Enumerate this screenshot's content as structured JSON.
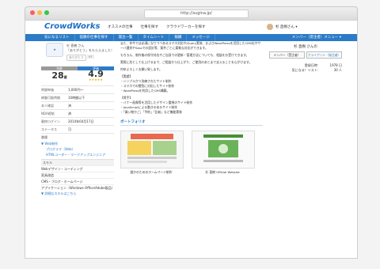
{
  "browser": {
    "url": "http://sugina.jp/"
  },
  "header": {
    "logo": "CrowdWorks",
    "links": [
      "オススメの仕事",
      "仕事を探す",
      "クラウドワーカーを探す"
    ],
    "user": "杉 直樹さん ▾"
  },
  "nav": {
    "items": [
      "気になるリスト",
      "宿題の仕事を探す",
      "発注一覧",
      "タイムシート",
      "報酬",
      "メッセージ"
    ],
    "right": "メンバー（受注者）メニュー ▾"
  },
  "profile": {
    "name": "杉 直樹 さん",
    "catch": "「ありがとう」をもらえました！",
    "thanks_label": "ありがとう",
    "thanks_count": "97",
    "stat_age_label": "年齢",
    "stat_age_value": "28",
    "stat_age_unit": "歳",
    "stat_rating_label": "評価",
    "stat_rating_value": "4.9",
    "stars": "★★★★★",
    "rows": [
      {
        "k": "時間単価",
        "v": "1,000円〜"
      },
      {
        "k": "稼働可能時間",
        "v": "10時間以下"
      },
      {
        "k": "本人確認",
        "v": "済"
      },
      {
        "k": "NDA締結",
        "v": "済"
      },
      {
        "k": "最終ログイン",
        "v": "2014年04月17日"
      },
      {
        "k": "ステータス",
        "v": "可"
      },
      {
        "k": "職種",
        "v": ""
      }
    ],
    "web_label": "▼ Web制作",
    "links": [
      "プログラマ（Web）",
      "HTMLコーダー・マークアップエンジニア"
    ],
    "skill_label": "スキル",
    "skills": [
      "Webデザイン・コーディング",
      "家具改造",
      "CMS・ブログ・ホームページ",
      "アプリケーション（Windows Office/Adobe製品）"
    ],
    "more": "▼ 詳細なスキルはこちら"
  },
  "main": {
    "paragraphs": [
      "また、作今では必須になりつつあるスマホ対応やjQuery実装、およびWordPressを活用したCMS化やサーバ選択やSassでの設計等、案件ごとに柔軟な対応ができます。",
      "もちろん、制作後の保守対応やご自身での更新・管理方法についても、相談をお受けできます。",
      "実際に形として仕上げるまで、ご相談から仕上がり、ご使用のあとまで支えることを心がけます。",
      "何卒よろしくお願い致します。",
      "【実績】\n・シンプルかつ洗練されたサイト制作\n・スマホでの閲覧に対応したサイト制作\n・WordPressを利用したCMS構築。",
      "【得手】\n・バナー画像等を活用したデザイン重視のサイト制作\n・JavaScriptによる動きのあるサイト制作\n・「買い物かご」「予約」「比較」など機能実装"
    ],
    "portfolio_title": "ポートフォリオ",
    "portfolio": [
      {
        "caption": "誰かのためのホームページ制作"
      },
      {
        "caption": "杉 直樹 Official Website"
      }
    ]
  },
  "right": {
    "name": "杉 直樹 さんの",
    "btn1": "メンバー（受注者）",
    "btn2": "クライアント（発注者）",
    "stat1_k": "登録日時：",
    "stat1_v": "1978 日",
    "stat2_k": "気になる！リスト：",
    "stat2_v": "30 人"
  },
  "colors": {
    "brand": "#1a6fc4",
    "nav": "#2b7bc8",
    "star": "#f5a623"
  }
}
